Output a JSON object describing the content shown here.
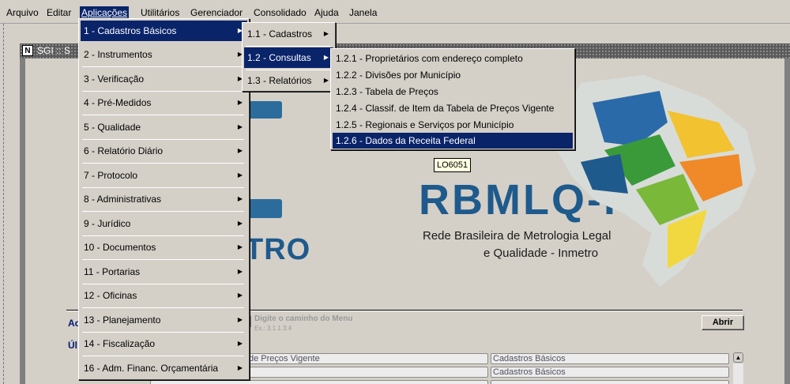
{
  "menubar": {
    "items": [
      "Arquivo",
      "Editar",
      "Aplicações",
      "Utilitários",
      "Gerenciador",
      "Consolidado",
      "Ajuda",
      "Janela"
    ],
    "active": "Aplicações"
  },
  "window": {
    "title": "SGI :: S"
  },
  "menus": {
    "aplicacoes": [
      "1 - Cadastros Básicos",
      "2 - Instrumentos",
      "3 - Verificação",
      "4 - Pré-Medidos",
      "5 - Qualidade",
      "6 - Relatório Diário",
      "7 - Protocolo",
      "8 - Administrativas",
      "9 - Jurídico",
      "10 - Documentos",
      "11 - Portarias",
      "12 - Oficinas",
      "13 - Planejamento",
      "14 - Fiscalização",
      "16 - Adm. Financ. Orçamentária"
    ],
    "cadastros_basicos": [
      "1.1 - Cadastros",
      "1.2 - Consultas",
      "1.3 - Relatórios"
    ],
    "consultas": [
      "1.2.1 - Proprietários com endereço completo",
      "1.2.2 - Divisões por Município",
      "1.2.3 - Tabela de Preços",
      "1.2.4 - Classif. de Item da Tabela de Preços Vigente",
      "1.2.5 - Regionais e Serviços por Município",
      "1.2.6 - Dados da Receita Federal"
    ]
  },
  "tooltip": "LO6051",
  "logo": {
    "left_text": "TRO",
    "rbmlq_title": "RBMLQ-I",
    "rbmlq_line1": "Rede Brasileira de Metrologia Legal",
    "rbmlq_line2": "e Qualidade - Inmetro"
  },
  "form": {
    "acesso_label": "Ac",
    "ultimos_label": "Úl",
    "path_placeholder": "Digite o caminho do Menu",
    "path_example": "Ex.: 3.1.1.3.4",
    "open_button": "Abrir"
  },
  "recent": [
    {
      "name": "de Preços Vigente",
      "group": "Cadastros Básicos"
    },
    {
      "name": "",
      "group": "Cadastros Básicos"
    }
  ],
  "colors": {
    "menu_highlight": "#0a246a",
    "logo_blue": "#1f5a8c"
  }
}
